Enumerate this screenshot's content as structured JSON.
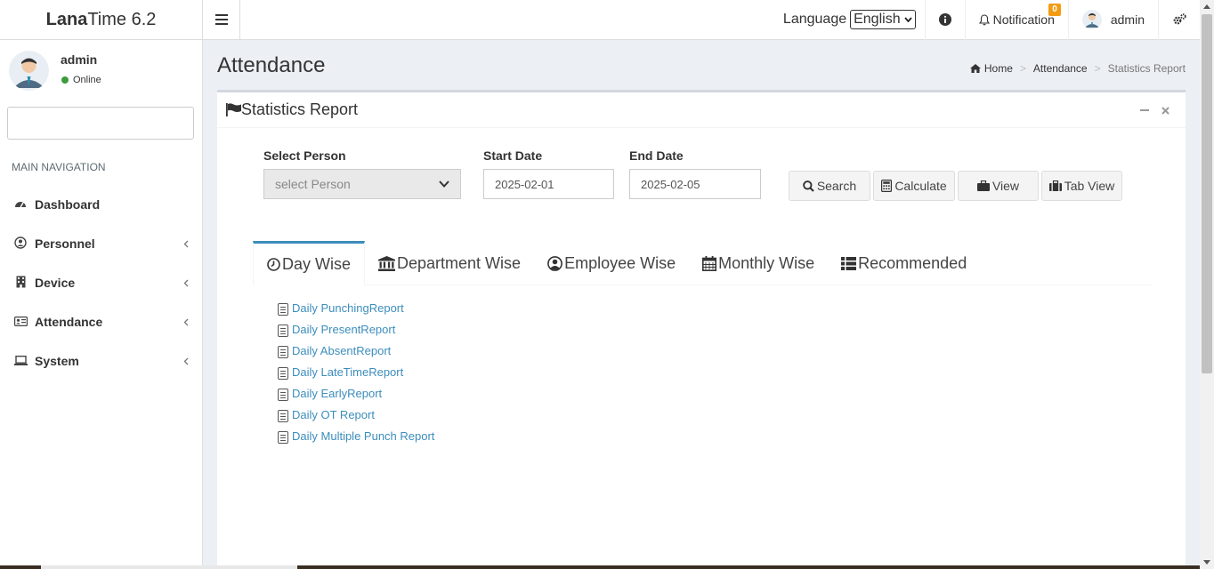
{
  "app": {
    "logo_bold": "Lana",
    "logo_rest": "Time 6.2"
  },
  "header": {
    "language_label": "Language",
    "language_value": "English",
    "notification_label": "Notification",
    "notification_count": "0",
    "user_name": "admin"
  },
  "sidebar": {
    "user_name": "admin",
    "status": "Online",
    "nav_header": "MAIN NAVIGATION",
    "items": [
      {
        "label": "Dashboard",
        "icon": "dashboard-icon"
      },
      {
        "label": "Personnel",
        "icon": "user-icon"
      },
      {
        "label": "Device",
        "icon": "building-icon"
      },
      {
        "label": "Attendance",
        "icon": "id-card-icon"
      },
      {
        "label": "System",
        "icon": "laptop-icon"
      }
    ]
  },
  "page": {
    "title": "Attendance",
    "breadcrumb": [
      "Home",
      "Attendance",
      "Statistics Report"
    ]
  },
  "box": {
    "title": "Statistics Report",
    "select_person_label": "Select Person",
    "select_person_placeholder": "select Person",
    "start_date_label": "Start Date",
    "start_date_value": "2025-02-01",
    "end_date_label": "End Date",
    "end_date_value": "2025-02-05",
    "buttons": {
      "search": "Search",
      "calculate": "Calculate",
      "view": "View",
      "tab_view": "Tab View"
    },
    "tabs": [
      "Day Wise",
      "Department Wise",
      "Employee Wise",
      "Monthly Wise",
      "Recommended"
    ],
    "reports": [
      "Daily PunchingReport",
      "Daily PresentReport",
      "Daily AbsentReport",
      "Daily LateTimeReport",
      "Daily EarlyReport",
      "Daily OT Report",
      "Daily Multiple Punch Report"
    ]
  },
  "colors": {
    "accent": "#3c8dbc",
    "badge": "#f39c12",
    "online": "#3c9b3c"
  }
}
